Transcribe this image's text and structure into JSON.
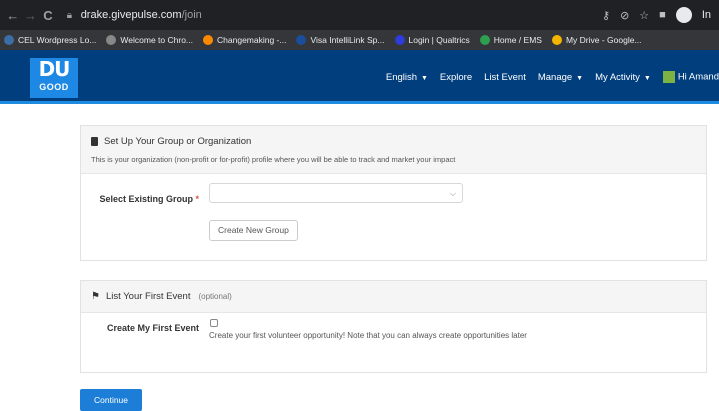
{
  "browser": {
    "back": "←",
    "forward": "→",
    "reload": "C",
    "url_host": "drake.givepulse.com",
    "url_path": "/join",
    "profile_label": "In",
    "bookmarks": [
      {
        "label": "CEL Wordpress Lo...",
        "icon": "wordpress-icon",
        "color": "#3a6ea5"
      },
      {
        "label": "Welcome to Chro...",
        "icon": "chrome-icon",
        "color": "#888888"
      },
      {
        "label": "Changemaking -...",
        "icon": "circle-icon",
        "color": "#ff8a00"
      },
      {
        "label": "Visa IntelliLink Sp...",
        "icon": "visa-icon",
        "color": "#1a4d9c"
      },
      {
        "label": "Login | Qualtrics",
        "icon": "qualtrics-icon",
        "color": "#2b3dd6"
      },
      {
        "label": "Home / EMS",
        "icon": "ems-icon",
        "color": "#2e9e4f"
      },
      {
        "label": "My Drive - Google...",
        "icon": "drive-icon",
        "color": "#f4b400"
      }
    ]
  },
  "header": {
    "logo_top": "DU",
    "logo_bottom": "GOOD",
    "nav": {
      "language": "English",
      "explore": "Explore",
      "list_event": "List Event",
      "manage": "Manage",
      "activity": "My Activity",
      "greeting": "Hi Amand"
    }
  },
  "group_panel": {
    "title": "Set Up Your Group or Organization",
    "description": "This is your organization (non-profit or for-profit) profile where you will be able to track and market your impact",
    "select_label": "Select Existing Group",
    "required_mark": "*",
    "select_value": "",
    "create_button": "Create New Group"
  },
  "event_panel": {
    "title": "List Your First Event",
    "optional": "(optional)",
    "checkbox_label": "Create My First Event",
    "checkbox_text": "Create your first volunteer opportunity! Note that you can always create opportunities later",
    "checked": false
  },
  "continue_button": "Continue",
  "colors": {
    "header_bg": "#003e7e",
    "accent": "#1f8be0",
    "primary_button": "#1c7ed6"
  }
}
